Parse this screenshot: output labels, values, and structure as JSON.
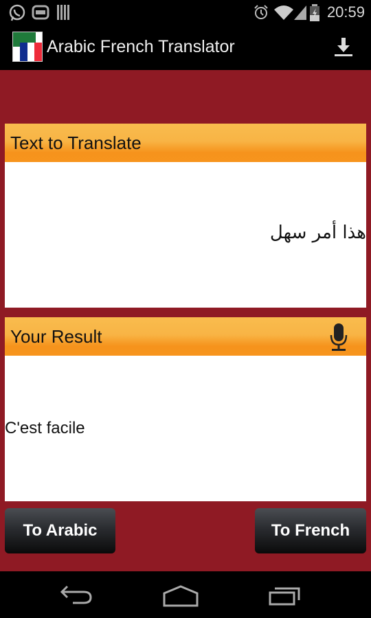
{
  "status_bar": {
    "left_icons": [
      "whatsapp-icon",
      "link-icon",
      "barcode-icon"
    ],
    "right_icons": [
      "alarm-icon",
      "wifi-icon",
      "signal-icon",
      "battery-charging-icon"
    ],
    "time": "20:59"
  },
  "action_bar": {
    "title": "Arabic French Translator",
    "logo": "arabic-french-flag-icon",
    "action_icon": "download-icon"
  },
  "source_panel": {
    "header": "Text to Translate",
    "text": "هذا أمر سهل"
  },
  "result_panel": {
    "header": "Your Result",
    "header_icon": "microphone-icon",
    "text": "C'est facile"
  },
  "buttons": {
    "to_arabic": "To Arabic",
    "to_french": "To French"
  },
  "nav_bar": {
    "icons": [
      "back-icon",
      "home-icon",
      "recents-icon"
    ]
  },
  "colors": {
    "background": "#8f1a24",
    "header_orange": "#f7941d",
    "button_dark": "#1a1b1e"
  }
}
